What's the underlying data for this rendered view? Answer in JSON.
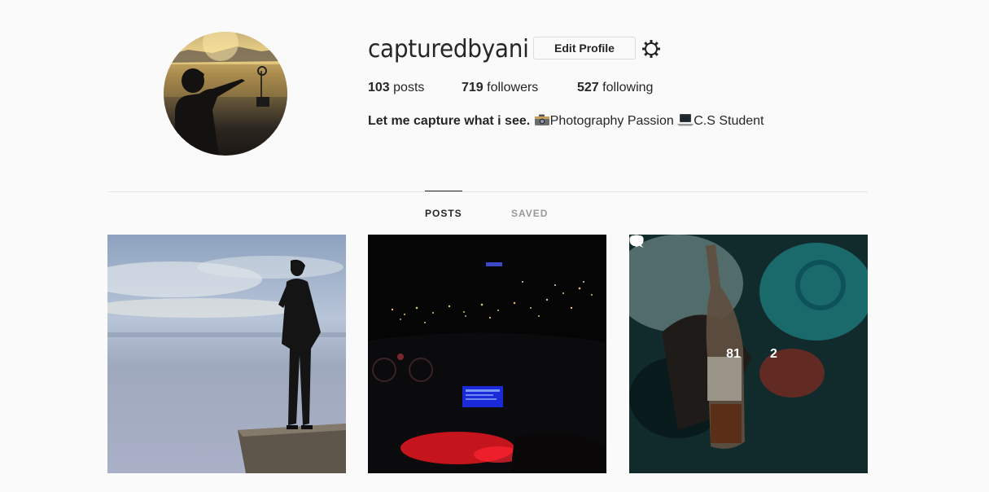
{
  "profile": {
    "username": "capturedbyani",
    "edit_label": "Edit Profile",
    "stats": {
      "posts_count": "103",
      "posts_label": "posts",
      "followers_count": "719",
      "followers_label": "followers",
      "following_count": "527",
      "following_label": "following"
    },
    "bio": {
      "name": "Let me capture what i see.",
      "line1": "Photography Passion",
      "line2": "C.S Student"
    }
  },
  "tabs": [
    {
      "label": "POSTS",
      "active": true
    },
    {
      "label": "SAVED",
      "active": false
    }
  ],
  "posts": [
    {
      "scene": "man-standing-on-cliff-above-clouds"
    },
    {
      "scene": "car-dashboard-at-night"
    },
    {
      "scene": "corona-bottle-at-party",
      "hover": {
        "likes": "81",
        "comments": "2"
      }
    }
  ],
  "colors": {
    "text": "#262626",
    "muted": "#999999",
    "border": "#dbdbdb",
    "background": "#fafafa"
  },
  "icons": [
    "gear-icon",
    "camera-emoji-icon",
    "laptop-emoji-icon",
    "heart-icon",
    "comment-icon"
  ]
}
